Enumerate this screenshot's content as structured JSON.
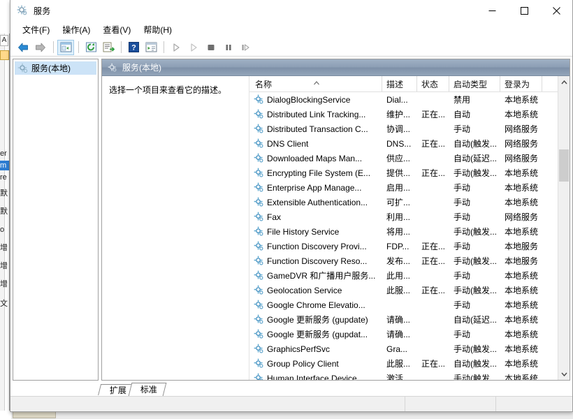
{
  "window": {
    "title": "服务",
    "icon": "gear-icon",
    "controls": {
      "minimize": "–",
      "maximize": "□",
      "close": "×"
    }
  },
  "menubar": {
    "items": [
      {
        "label": "文件(F)",
        "name": "menu-file"
      },
      {
        "label": "操作(A)",
        "name": "menu-action"
      },
      {
        "label": "查看(V)",
        "name": "menu-view"
      },
      {
        "label": "帮助(H)",
        "name": "menu-help"
      }
    ]
  },
  "toolbar": {
    "buttons": [
      {
        "name": "back-icon",
        "title": "后退"
      },
      {
        "name": "forward-icon",
        "title": "前进"
      },
      {
        "name": "show-hide-tree-icon",
        "title": "显示/隐藏控制台树"
      },
      {
        "name": "refresh-icon",
        "title": "刷新"
      },
      {
        "name": "export-list-icon",
        "title": "导出列表"
      },
      {
        "name": "help-icon",
        "title": "帮助"
      },
      {
        "name": "properties-icon",
        "title": "属性"
      },
      {
        "name": "start-service-icon",
        "title": "启动服务"
      },
      {
        "name": "restart-service-icon",
        "title": "重启动服务"
      },
      {
        "name": "stop-service-icon",
        "title": "停止服务"
      },
      {
        "name": "pause-service-icon",
        "title": "暂停服务"
      },
      {
        "name": "resume-service-icon",
        "title": "恢复服务"
      }
    ]
  },
  "tree": {
    "nodes": [
      {
        "label": "服务(本地)",
        "icon": "gear-icon",
        "selected": true
      }
    ]
  },
  "right_pane": {
    "header": "服务(本地)",
    "header_icon": "gear-icon",
    "description_placeholder": "选择一个项目来查看它的描述。"
  },
  "list": {
    "columns": [
      {
        "label": "名称",
        "key": "name",
        "sorted": "asc"
      },
      {
        "label": "描述",
        "key": "desc"
      },
      {
        "label": "状态",
        "key": "state"
      },
      {
        "label": "启动类型",
        "key": "start"
      },
      {
        "label": "登录为",
        "key": "logon"
      }
    ],
    "rows": [
      {
        "name": "DialogBlockingService",
        "desc": "Dial...",
        "state": "",
        "start": "禁用",
        "logon": "本地系统"
      },
      {
        "name": "Distributed Link Tracking...",
        "desc": "维护...",
        "state": "正在...",
        "start": "自动",
        "logon": "本地系统"
      },
      {
        "name": "Distributed Transaction C...",
        "desc": "协调...",
        "state": "",
        "start": "手动",
        "logon": "网络服务"
      },
      {
        "name": "DNS Client",
        "desc": "DNS...",
        "state": "正在...",
        "start": "自动(触发...",
        "logon": "网络服务"
      },
      {
        "name": "Downloaded Maps Man...",
        "desc": "供应...",
        "state": "",
        "start": "自动(延迟...",
        "logon": "网络服务"
      },
      {
        "name": "Encrypting File System (E...",
        "desc": "提供...",
        "state": "正在...",
        "start": "手动(触发...",
        "logon": "本地系统"
      },
      {
        "name": "Enterprise App Manage...",
        "desc": "启用...",
        "state": "",
        "start": "手动",
        "logon": "本地系统"
      },
      {
        "name": "Extensible Authentication...",
        "desc": "可扩...",
        "state": "",
        "start": "手动",
        "logon": "本地系统"
      },
      {
        "name": "Fax",
        "desc": "利用...",
        "state": "",
        "start": "手动",
        "logon": "网络服务"
      },
      {
        "name": "File History Service",
        "desc": "将用...",
        "state": "",
        "start": "手动(触发...",
        "logon": "本地系统"
      },
      {
        "name": "Function Discovery Provi...",
        "desc": "FDP...",
        "state": "正在...",
        "start": "手动",
        "logon": "本地服务"
      },
      {
        "name": "Function Discovery Reso...",
        "desc": "发布...",
        "state": "正在...",
        "start": "手动(触发...",
        "logon": "本地服务"
      },
      {
        "name": "GameDVR 和广播用户服务...",
        "desc": "此用...",
        "state": "",
        "start": "手动",
        "logon": "本地系统"
      },
      {
        "name": "Geolocation Service",
        "desc": "此服...",
        "state": "正在...",
        "start": "手动(触发...",
        "logon": "本地系统"
      },
      {
        "name": "Google Chrome Elevatio...",
        "desc": "",
        "state": "",
        "start": "手动",
        "logon": "本地系统"
      },
      {
        "name": "Google 更新服务 (gupdate)",
        "desc": "请确...",
        "state": "",
        "start": "自动(延迟...",
        "logon": "本地系统"
      },
      {
        "name": "Google 更新服务 (gupdat...",
        "desc": "请确...",
        "state": "",
        "start": "手动",
        "logon": "本地系统"
      },
      {
        "name": "GraphicsPerfSvc",
        "desc": "Gra...",
        "state": "",
        "start": "手动(触发...",
        "logon": "本地系统"
      },
      {
        "name": "Group Policy Client",
        "desc": "此服...",
        "state": "正在...",
        "start": "自动(触发...",
        "logon": "本地系统"
      },
      {
        "name": "Human Interface Device...",
        "desc": "激活...",
        "state": "",
        "start": "手动(触发...",
        "logon": "本地系统"
      }
    ]
  },
  "view_tabs": [
    {
      "label": "扩展",
      "selected": false
    },
    {
      "label": "标准",
      "selected": true
    }
  ],
  "statusbar": {
    "main": "",
    "secondary": "",
    "tertiary": ""
  },
  "colors": {
    "header_gradient_top": "#9fb0c4",
    "header_gradient_bottom": "#93a5b9",
    "tree_selection": "#cce3f7",
    "toolbar_active": "#dff0fb",
    "service_icon": "#3f8fc0",
    "back_arrow": "#2a8ad4",
    "forward_arrow": "#9a9a9a",
    "help_badge": "#1b4f9c"
  }
}
